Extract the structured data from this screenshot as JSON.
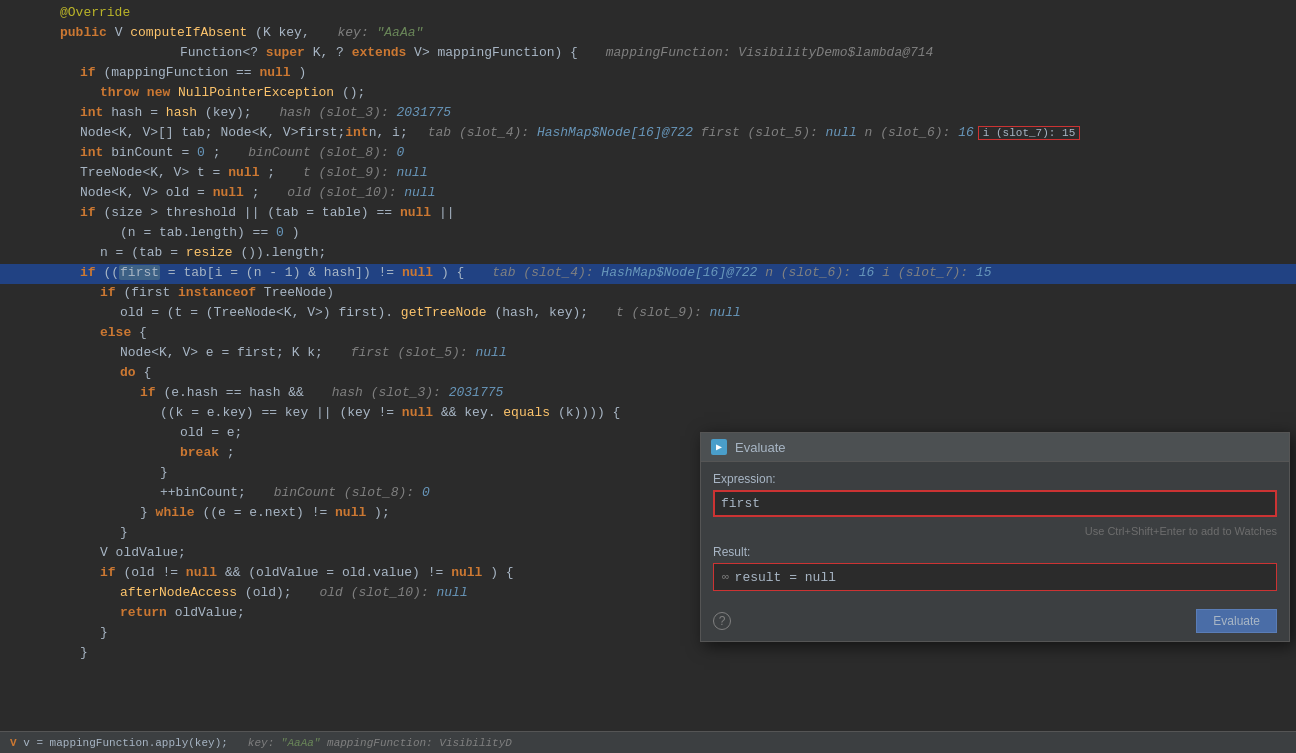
{
  "dialog": {
    "title": "Evaluate",
    "icon_label": "▶",
    "expression_label": "Expression:",
    "expression_value": "first",
    "hint": "Use Ctrl+Shift+Enter to add to Watches",
    "result_label": "Result:",
    "result_value": "result = null",
    "evaluate_button": "Evaluate"
  },
  "debug_bar": {
    "text": "V v = mappingFunction.apply(key);",
    "debug_info": "key: \"AaAa\"     mappingFunction: VisibilityD"
  },
  "code": {
    "lines": [
      {
        "id": 1,
        "text": "@Override",
        "type": "annotation"
      },
      {
        "id": 2,
        "text": "public V computeIfAbsent(K key,   key: \"AaAa\"",
        "type": "normal"
      },
      {
        "id": 3,
        "text": "                        Function<? super K, ? extends V> mappingFunction) {   mappingFunction: VisibilityDemo$lambda@714",
        "type": "normal"
      },
      {
        "id": 4,
        "text": "    if (mappingFunction == null)",
        "type": "normal"
      },
      {
        "id": 5,
        "text": "        throw new NullPointerException();",
        "type": "normal"
      },
      {
        "id": 6,
        "text": "    int hash = hash(key);   hash (slot_3): 2031775",
        "type": "normal"
      },
      {
        "id": 7,
        "text": "    Node<K, V>[] tab; Node<K, V> first; int n, i;   tab (slot_4): HashMap$Node[16]@722    first (slot_5): null    n (slot_6): 16",
        "type": "normal",
        "has_slot_box": true,
        "slot_box_text": "i (slot_7): 15"
      },
      {
        "id": 8,
        "text": "    int binCount = 0;   binCount (slot_8): 0",
        "type": "normal"
      },
      {
        "id": 9,
        "text": "    TreeNode<K, V> t = null;   t (slot_9): null",
        "type": "normal"
      },
      {
        "id": 10,
        "text": "    Node<K, V> old = null;   old (slot_10): null",
        "type": "normal"
      },
      {
        "id": 11,
        "text": "    if (size > threshold || (tab = table) == null ||",
        "type": "normal"
      },
      {
        "id": 12,
        "text": "            (n = tab.length) == 0)",
        "type": "normal"
      },
      {
        "id": 13,
        "text": "        n = (tab = resize()).length;",
        "type": "normal"
      },
      {
        "id": 14,
        "text": "    if ((first = tab[i = (n - 1) & hash]) != null) {   tab (slot_4): HashMap$Node[16]@722    n (slot_6): 16    i (slot_7): 15",
        "type": "highlighted"
      },
      {
        "id": 15,
        "text": "        if (first instanceof TreeNode)",
        "type": "normal"
      },
      {
        "id": 16,
        "text": "            old = (t = (TreeNode<K, V>) first).getTreeNode(hash, key);   t (slot_9): null",
        "type": "normal"
      },
      {
        "id": 17,
        "text": "        else {",
        "type": "normal"
      },
      {
        "id": 18,
        "text": "            Node<K, V> e = first; K k;   first (slot_5): null",
        "type": "normal"
      },
      {
        "id": 19,
        "text": "            do {",
        "type": "normal"
      },
      {
        "id": 20,
        "text": "                if (e.hash == hash &&   hash (slot_3): 2031775",
        "type": "normal"
      },
      {
        "id": 21,
        "text": "                        ((k = e.key) == key || (key != null && key.equals(k)))) {",
        "type": "normal"
      },
      {
        "id": 22,
        "text": "                    old = e;",
        "type": "normal"
      },
      {
        "id": 23,
        "text": "                    break;",
        "type": "normal"
      },
      {
        "id": 24,
        "text": "                }",
        "type": "normal"
      },
      {
        "id": 25,
        "text": "                ++binCount;   binCount (slot_8): 0",
        "type": "normal"
      },
      {
        "id": 26,
        "text": "            } while ((e = e.next) != null);",
        "type": "normal"
      },
      {
        "id": 27,
        "text": "        }",
        "type": "normal"
      },
      {
        "id": 28,
        "text": "        V oldValue;",
        "type": "normal"
      },
      {
        "id": 29,
        "text": "        if (old != null && (oldValue = old.value) != null) {",
        "type": "normal"
      },
      {
        "id": 30,
        "text": "            afterNodeAccess(old);   old (slot_10): null",
        "type": "normal"
      },
      {
        "id": 31,
        "text": "            return oldValue;",
        "type": "normal"
      },
      {
        "id": 32,
        "text": "        }",
        "type": "normal"
      },
      {
        "id": 33,
        "text": "    }",
        "type": "normal"
      }
    ]
  }
}
